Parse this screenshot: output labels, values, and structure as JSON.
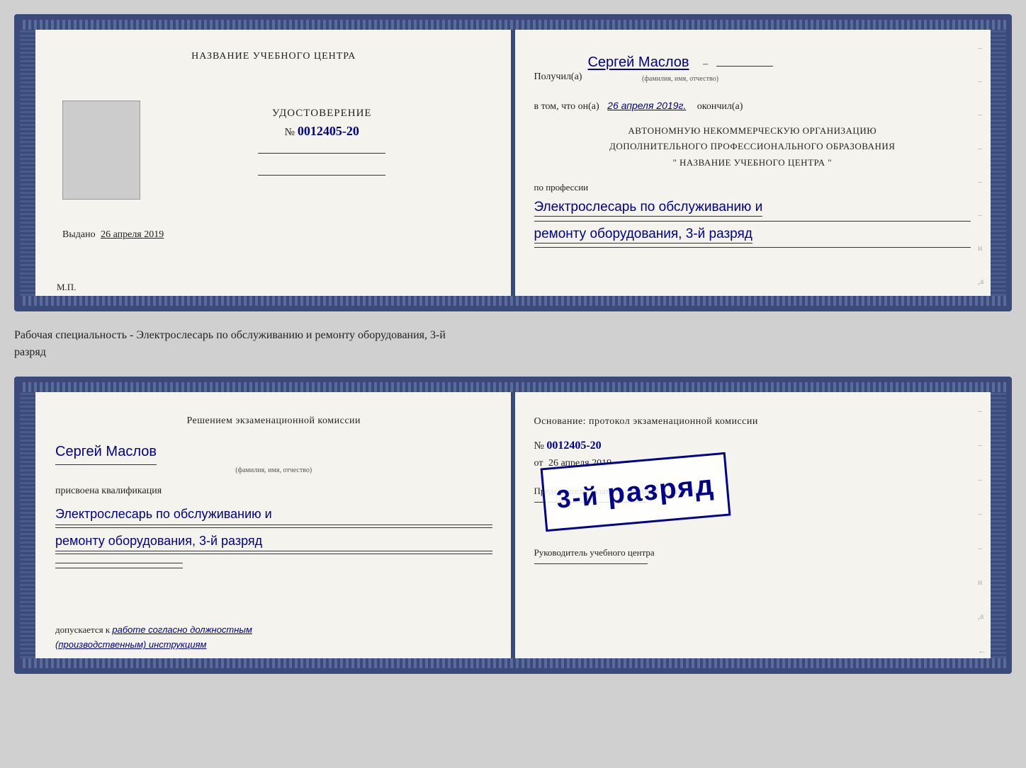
{
  "card1": {
    "left": {
      "center_name": "НАЗВАНИЕ УЧЕБНОГО ЦЕНТРА",
      "udostoverenie_title": "УДОСТОВЕРЕНИЕ",
      "number_label": "№",
      "number_value": "0012405-20",
      "vydano_label": "Выдано",
      "vydano_date": "26 апреля 2019",
      "mp_label": "М.П."
    },
    "right": {
      "poluchil_label": "Получил(а)",
      "recipient_name": "Сергей Маслов",
      "fio_hint": "(фамилия, имя, отчество)",
      "vtom_label": "в том, что он(а)",
      "completion_date": "26 апреля 2019г.",
      "okончил_label": "окончил(а)",
      "org_line1": "АВТОНОМНУЮ НЕКОММЕРЧЕСКУЮ ОРГАНИЗАЦИЮ",
      "org_line2": "ДОПОЛНИТЕЛЬНОГО ПРОФЕССИОНАЛЬНОГО ОБРАЗОВАНИЯ",
      "org_line3": "\"   НАЗВАНИЕ УЧЕБНОГО ЦЕНТРА   \"",
      "po_professii": "по профессии",
      "profession_line1": "Электрослесарь по обслуживанию и",
      "profession_line2": "ремонту оборудования, 3-й разряд"
    }
  },
  "between_label": "Рабочая специальность - Электрослесарь по обслуживанию и ремонту оборудования, 3-й\nразряд",
  "card2": {
    "left": {
      "resheniem_title": "Решением экзаменационной комиссии",
      "name": "Сергей Маслов",
      "fio_hint": "(фамилия, имя, отчество)",
      "prisvoena": "присвоена квалификация",
      "profession_line1": "Электрослесарь по обслуживанию и",
      "profession_line2": "ремонту оборудования, 3-й разряд",
      "dopuskaetsya_label": "допускается к",
      "dopuskaetsya_value": "работе согласно должностным (производственным) инструкциям"
    },
    "right": {
      "osnovanie_title": "Основание: протокол экзаменационной комиссии",
      "number_label": "№",
      "number_value": "0012405-20",
      "ot_label": "от",
      "ot_date": "26 апреля 2019",
      "predsedatel_label": "Председатель экзаменационной комиссии",
      "rukovoditel_label": "Руководитель учебного центра"
    },
    "stamp": {
      "main": "3-й разряд",
      "line1": "3-й",
      "line2": "разряд"
    }
  }
}
